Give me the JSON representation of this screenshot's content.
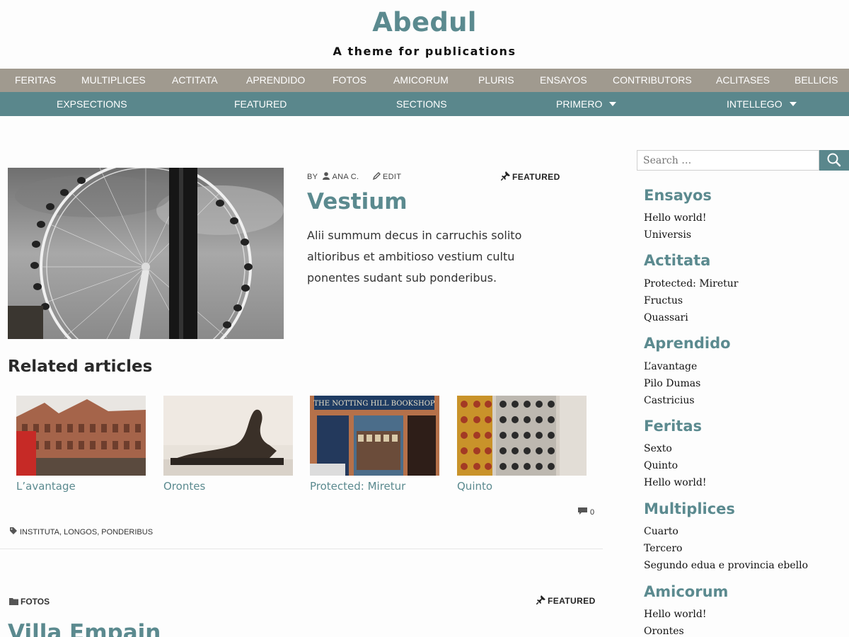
{
  "header": {
    "site_title": "Abedul",
    "tagline": "A theme for publications"
  },
  "menu_primary": [
    "Feritas",
    "Multiplices",
    "Actitata",
    "Aprendido",
    "Fotos",
    "Amicorum",
    "Pluris",
    "Ensayos",
    "Contributors",
    "Aclitases",
    "Bellicis"
  ],
  "menu_secondary": [
    "Expsections",
    "Featured",
    "Sections",
    "Primero",
    "Intellego"
  ],
  "post": {
    "by_label": "by",
    "author": "Ana C.",
    "edit_label": "Edit",
    "featured_label": "Featured",
    "title": "Vestium",
    "excerpt": "Alii summum decus in carruchis solito altioribus et ambitioso vestium cultu ponentes sudant sub ponderibus.",
    "related_heading": "Related articles",
    "related": [
      "L’avantage",
      "Orontes",
      "Protected: Miretur",
      "Quinto"
    ],
    "comment_count": "0",
    "tags": "Instituta, Longos, Ponderibus"
  },
  "post2": {
    "category": "Fotos",
    "featured_label": "Featured",
    "title": "Villa Empain"
  },
  "sidebar": {
    "search_placeholder": "Search …",
    "sections": [
      {
        "heading": "Ensayos",
        "links": [
          "Hello world!",
          "Universis"
        ]
      },
      {
        "heading": "Actitata",
        "links": [
          "Protected: Miretur",
          "Fructus",
          "Quassari"
        ]
      },
      {
        "heading": "Aprendido",
        "links": [
          "L’avantage",
          "Pilo Dumas",
          "Castricius"
        ]
      },
      {
        "heading": "Feritas",
        "links": [
          "Sexto",
          "Quinto",
          "Hello world!"
        ]
      },
      {
        "heading": "Multiplices",
        "links": [
          "Cuarto",
          "Tercero",
          "Segundo edua e provincia ebello"
        ]
      },
      {
        "heading": "Amicorum",
        "links": [
          "Hello world!",
          "Orontes"
        ]
      }
    ]
  },
  "colors": {
    "accent": "#5b8a8f",
    "menu_primary_bg": "#a09a8f",
    "menu_secondary_bg": "#5a878c"
  }
}
